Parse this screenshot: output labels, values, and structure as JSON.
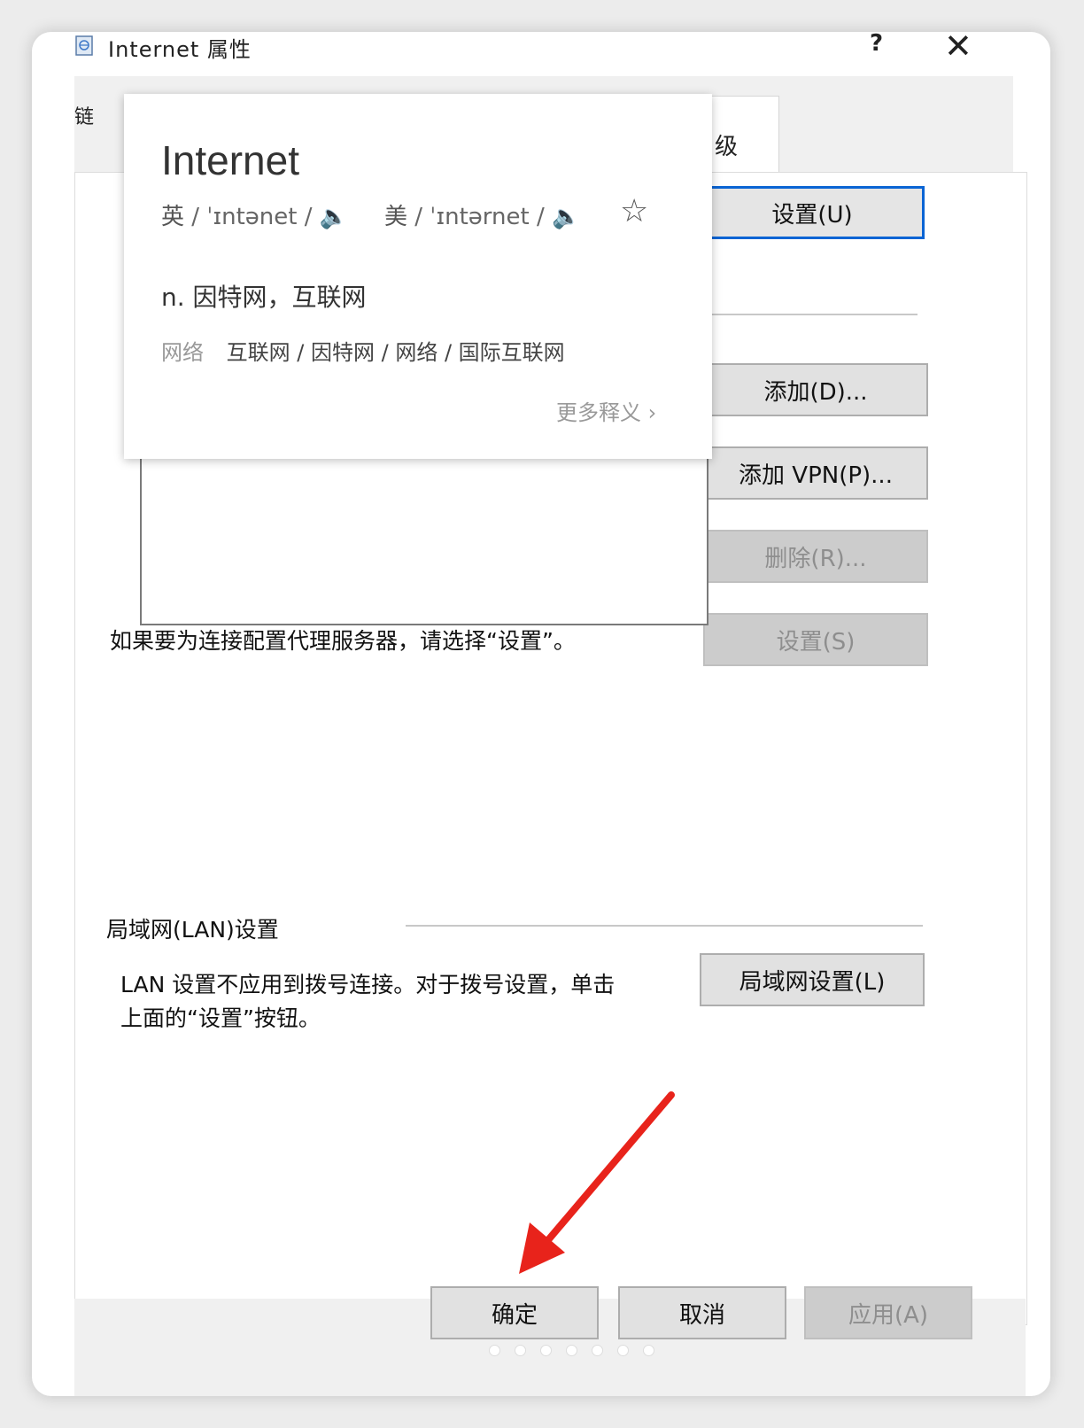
{
  "window": {
    "title": "Internet 属性",
    "help_label": "?",
    "close_label": "✕",
    "tab_left_fragment": "链",
    "tab_right_fragment": "级"
  },
  "buttons": {
    "setup": "设置(U)",
    "add": "添加(D)...",
    "add_vpn": "添加 VPN(P)...",
    "delete": "删除(R)...",
    "settings": "设置(S)",
    "lan_settings": "局域网设置(L)",
    "ok": "确定",
    "cancel": "取消",
    "apply": "应用(A)"
  },
  "texts": {
    "proxy_hint": "如果要为连接配置代理服务器，请选择“设置”。",
    "lan_group_label": "局域网(LAN)设置",
    "lan_hint_line1": "LAN 设置不应用到拨号连接。对于拨号设置，单击",
    "lan_hint_line2": "上面的“设置”按钮。"
  },
  "dictionary_popup": {
    "word": "Internet",
    "uk_label": "英",
    "uk_phonetic": "/ ˈɪntənet /",
    "us_label": "美",
    "us_phonetic": "/ ˈɪntərnet /",
    "definition": "n. 因特网，互联网",
    "net_tag": "网络",
    "net_meanings": "互联网 / 因特网 / 网络 / 国际互联网",
    "more_label": "更多释义 ›"
  },
  "colors": {
    "primary_border": "#0a64d4",
    "speaker": "#e03030",
    "arrow": "#e8231b"
  },
  "icons": [
    "app-icon",
    "speaker-icon",
    "star-icon",
    "close-icon"
  ]
}
